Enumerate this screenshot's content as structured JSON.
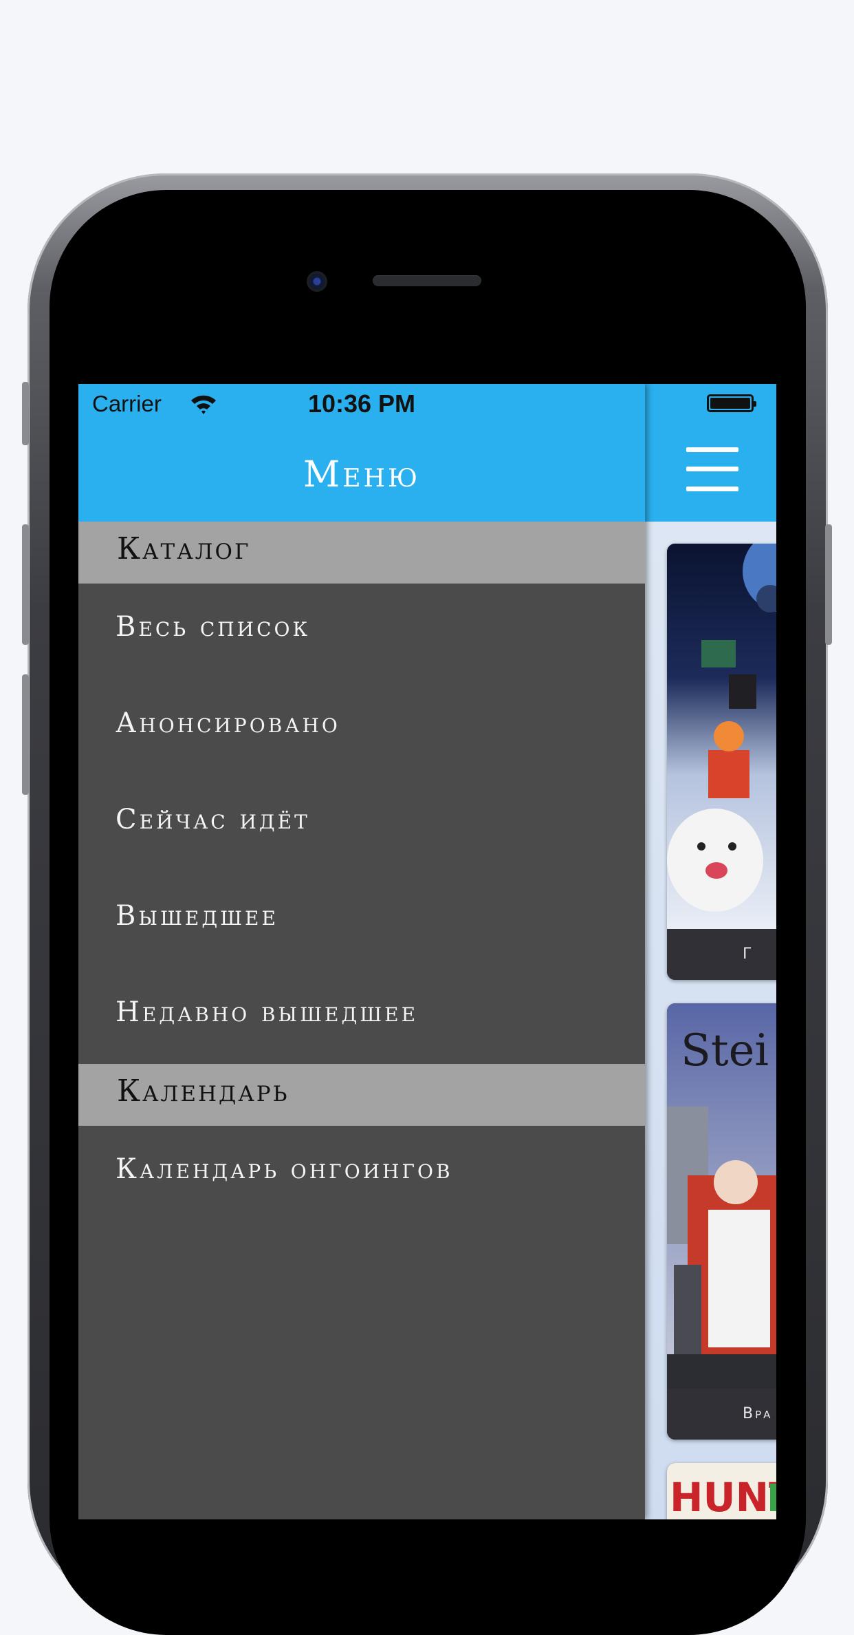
{
  "status_bar": {
    "carrier": "Carrier",
    "time": "10:36 PM"
  },
  "menu": {
    "title": "Меню",
    "sections": [
      {
        "label": "Каталог",
        "items": [
          "Весь список",
          "Анонсировано",
          "Сейчас идёт",
          "Вышедшее",
          "Недавно вышедшее"
        ]
      },
      {
        "label": "Календарь",
        "items": [
          "Календарь онгоингов"
        ]
      }
    ]
  },
  "main": {
    "cards": [
      {
        "caption": "Г"
      },
      {
        "caption": "Вра",
        "art_text": "Stei"
      },
      {
        "art_text": "HUNT"
      }
    ]
  },
  "colors": {
    "header": "#2ab0ee",
    "menu_bg": "#4b4b4b",
    "section_bg": "#a3a3a3"
  },
  "icons": [
    "wifi-icon",
    "battery-icon",
    "hamburger-menu-icon"
  ]
}
